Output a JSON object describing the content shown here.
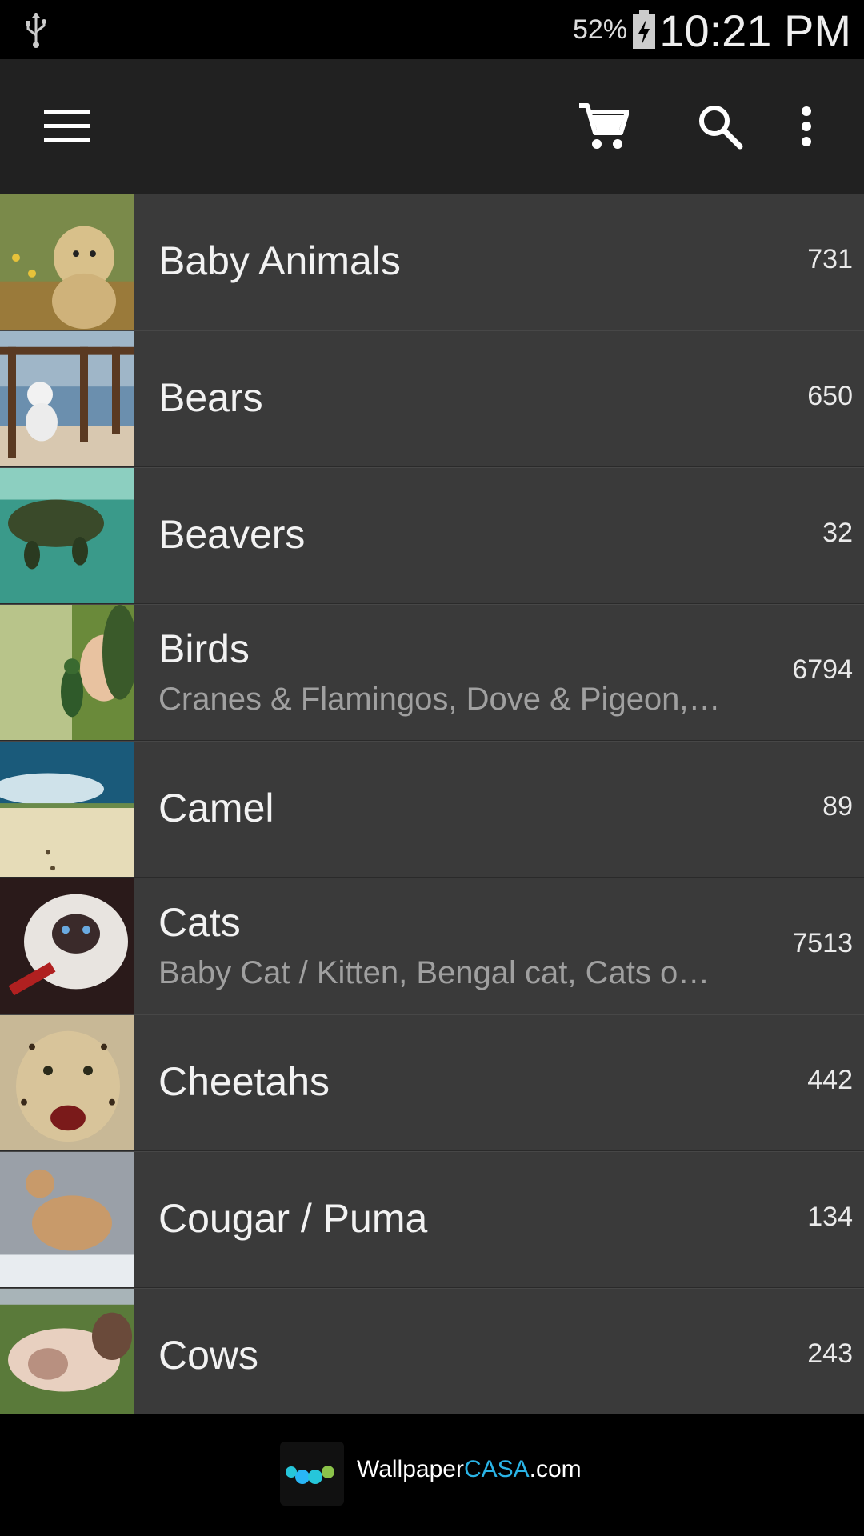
{
  "status_bar": {
    "battery_percent": "52%",
    "time": "10:21 PM",
    "icons": [
      "usb-icon",
      "battery-charging-icon"
    ]
  },
  "app_bar": {
    "icons": [
      "menu-icon",
      "cart-icon",
      "search-icon",
      "more-vert-icon"
    ]
  },
  "categories": [
    {
      "title": "Baby Animals",
      "subtitle": "",
      "count": "731"
    },
    {
      "title": "Bears",
      "subtitle": "",
      "count": "650"
    },
    {
      "title": "Beavers",
      "subtitle": "",
      "count": "32"
    },
    {
      "title": "Birds",
      "subtitle": "Cranes & Flamingos, Dove & Pigeon,…",
      "count": "6794"
    },
    {
      "title": "Camel",
      "subtitle": "",
      "count": "89"
    },
    {
      "title": "Cats",
      "subtitle": "Baby Cat / Kitten, Bengal cat, Cats o…",
      "count": "7513"
    },
    {
      "title": "Cheetahs",
      "subtitle": "",
      "count": "442"
    },
    {
      "title": "Cougar / Puma",
      "subtitle": "",
      "count": "134"
    },
    {
      "title": "Cows",
      "subtitle": "",
      "count": "243"
    }
  ],
  "footer": {
    "brand_prefix": "Wallpaper",
    "brand_accent": "CASA",
    "brand_suffix": ".com"
  },
  "colors": {
    "app_bar": "#212121",
    "row_bg": "#3a3a3a",
    "accent": "#2ab4e6"
  }
}
